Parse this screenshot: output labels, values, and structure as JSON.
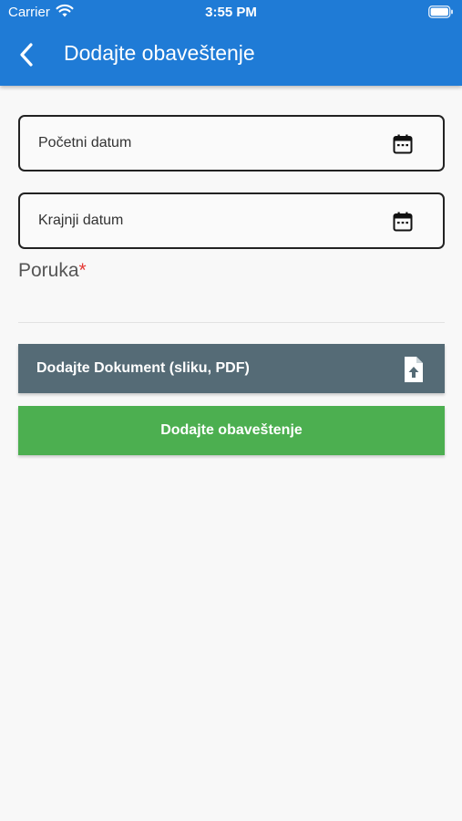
{
  "status_bar": {
    "carrier": "Carrier",
    "time": "3:55 PM"
  },
  "header": {
    "title": "Dodajte obaveštenje",
    "background_color": "#1f7bd6"
  },
  "form": {
    "start_date_label": "Početni datum",
    "end_date_label": "Krajnji datum",
    "message_label": "Poruka",
    "required_marker": "*",
    "message_value": ""
  },
  "buttons": {
    "upload_document_label": "Dodajte Dokument (sliku, PDF)",
    "upload_color": "#556b76",
    "submit_label": "Dodajte obaveštenje",
    "submit_color": "#4caf50"
  },
  "icons": {
    "back": "chevron-left-icon",
    "date": "calendar-icon",
    "upload": "file-upload-icon"
  }
}
